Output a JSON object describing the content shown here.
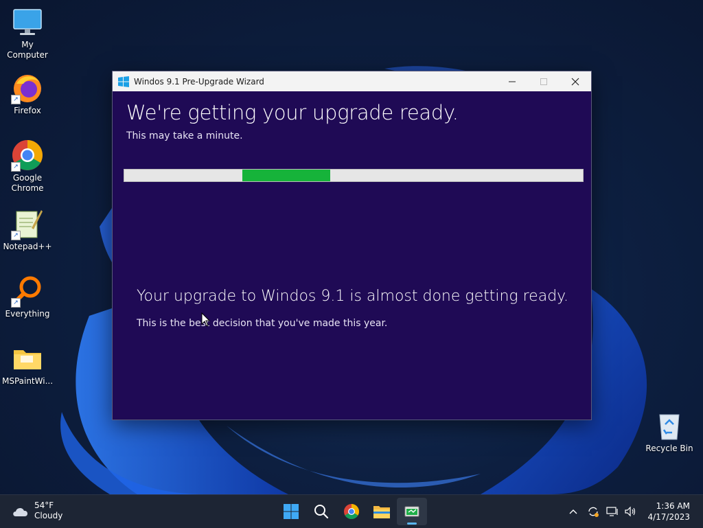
{
  "desktop": {
    "icons": [
      {
        "label": "My Computer"
      },
      {
        "label": "Firefox"
      },
      {
        "label": "Google Chrome"
      },
      {
        "label": "Notepad++"
      },
      {
        "label": "Everything"
      },
      {
        "label": "MSPaintWi..."
      },
      {
        "label": "Recycle Bin"
      }
    ]
  },
  "window": {
    "title": "Windos 9.1 Pre-Upgrade Wizard",
    "heading": "We're getting your upgrade ready.",
    "subheading": "This may take a minute.",
    "progress": {
      "start_fraction": 0.258,
      "end_fraction": 0.449,
      "fill_color": "#16b33a"
    },
    "status_heading": "Your upgrade to Windos 9.1 is almost done getting ready.",
    "status_text": "This is the best decision that you've made this year.",
    "controls": {
      "minimize": "minimize-icon",
      "maximize": "maximize-icon",
      "close": "close-icon"
    }
  },
  "taskbar": {
    "weather": {
      "temp": "54°F",
      "condition": "Cloudy"
    },
    "pinned": [
      "start-icon",
      "search-icon",
      "chrome-icon",
      "file-explorer-icon",
      "wizard-app-icon"
    ],
    "tray": {
      "time": "1:36 AM",
      "date": "4/17/2023"
    }
  },
  "colors": {
    "window_bg": "#1f0a55",
    "accent_green": "#16b33a",
    "taskbar_bg": "#1d2534"
  }
}
